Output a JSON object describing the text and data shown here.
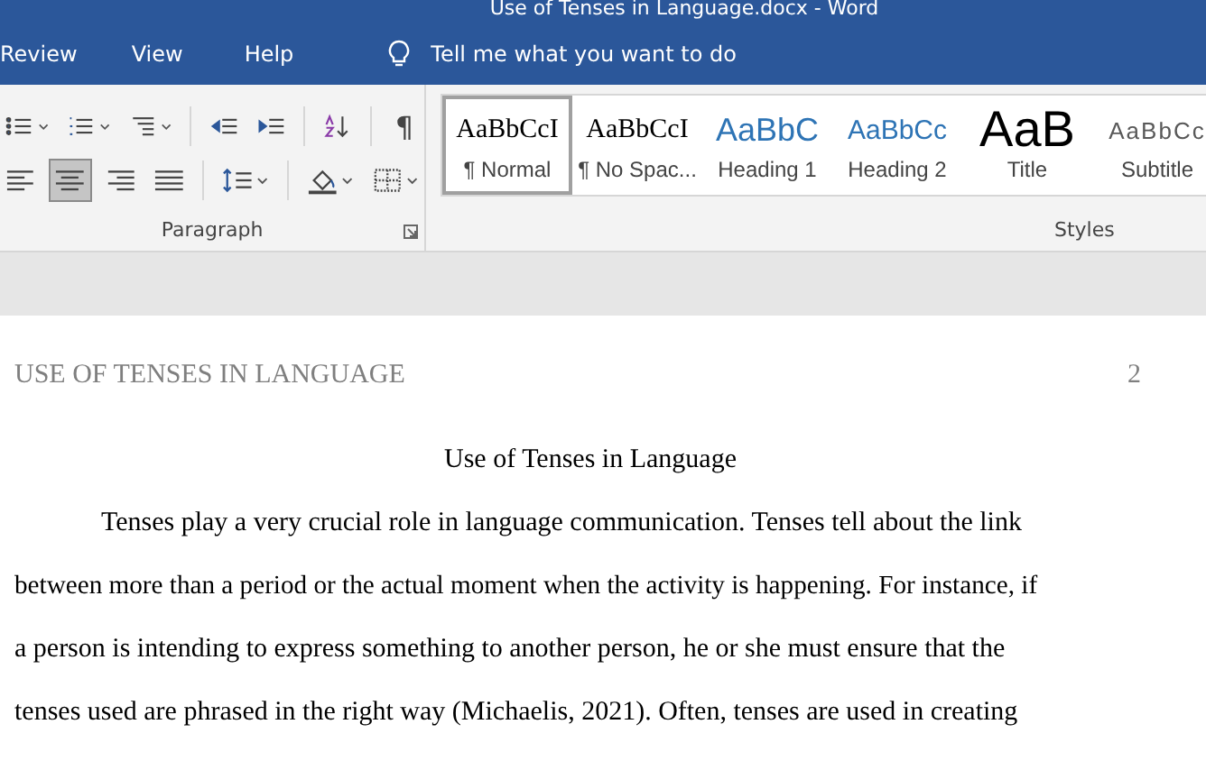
{
  "window": {
    "title": "Use of Tenses in Language.docx  -  Word"
  },
  "tabs": [
    "Review",
    "View",
    "Help"
  ],
  "tell_me": {
    "placeholder": "Tell me what you want to do"
  },
  "paragraph_group": {
    "label": "Paragraph",
    "show_marks": "¶",
    "align_buttons": [
      {
        "kind": "left",
        "selected": false
      },
      {
        "kind": "center",
        "selected": true
      },
      {
        "kind": "right",
        "selected": false
      },
      {
        "kind": "justify",
        "selected": false
      }
    ]
  },
  "styles": {
    "label": "Styles",
    "items": [
      {
        "preview": "AaBbCcI",
        "name": "¶ Normal",
        "kind": "normal",
        "selected": true
      },
      {
        "preview": "AaBbCcI",
        "name": "¶ No Spac...",
        "kind": "normal",
        "selected": false
      },
      {
        "preview": "AaBbC",
        "name": "Heading 1",
        "kind": "heading1",
        "selected": false
      },
      {
        "preview": "AaBbCc",
        "name": "Heading 2",
        "kind": "heading2",
        "selected": false
      },
      {
        "preview": "AaB",
        "name": "Title",
        "kind": "title",
        "selected": false
      },
      {
        "preview": "AaBbCc",
        "name": "Subtitle",
        "kind": "subtitle",
        "selected": false
      }
    ]
  },
  "document": {
    "header": "USE OF TENSES IN LANGUAGE",
    "page_number": "2",
    "title": "Use of Tenses in Language",
    "lines": [
      "Tenses play a very crucial role in language communication. Tenses tell about the link",
      "between more than a period or the actual moment when the activity is happening. For instance, if",
      "a person is intending to express something to another person, he or she must ensure that the",
      "tenses used are phrased in the right way (Michaelis, 2021). Often, tenses are used in creating"
    ]
  }
}
